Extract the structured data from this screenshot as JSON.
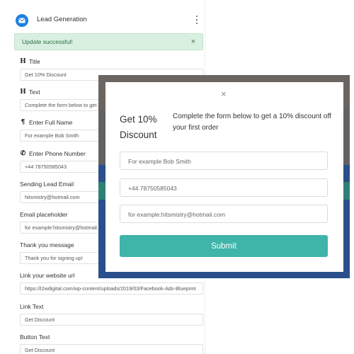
{
  "header": {
    "title": "Lead Generation",
    "app_icon": "envelope-icon",
    "menu_icon": "kebab-menu-icon"
  },
  "alert": {
    "text": "Update successful!",
    "close": "×"
  },
  "fields": [
    {
      "label": "Title",
      "icon": "heading-icon",
      "icon_glyph": "H",
      "value": "Get 10% Discount"
    },
    {
      "label": "Text",
      "icon": "heading-icon",
      "icon_glyph": "H",
      "value": "Complete the form below to get a"
    },
    {
      "label": "Enter Full Name",
      "icon": "paragraph-icon",
      "icon_glyph": "¶",
      "value": "For example Bob Smith"
    },
    {
      "label": "Enter Phone Number",
      "icon": "phone-icon",
      "icon_glyph": "✆",
      "value": "+44 78750585043"
    },
    {
      "label": "Sending Lead Email",
      "icon": "",
      "icon_glyph": "",
      "value": "hitsmistry@hotmail.com"
    },
    {
      "label": "Email placeholder",
      "icon": "",
      "icon_glyph": "",
      "value": "for example:hitsmistry@hotmail.com"
    },
    {
      "label": "Thank you message",
      "icon": "",
      "icon_glyph": "",
      "value": "Thank you for signing up!"
    },
    {
      "label": "Link your website url",
      "icon": "",
      "icon_glyph": "",
      "value": "https://i2wdigital.com/wp-content/uploads/2019/03/Facebook-Ads-Blueprint"
    },
    {
      "label": "Link Text",
      "icon": "",
      "icon_glyph": "",
      "value": "Get Discount"
    },
    {
      "label": "Button Text",
      "icon": "",
      "icon_glyph": "",
      "value": "Get Discount"
    }
  ],
  "popup": {
    "close": "×",
    "title": "Get 10% Discount",
    "description": "Complete the form below to get a 10% discount off your first order",
    "inputs": [
      "For example Bob Smith",
      "+44 78750585043",
      "for example:hitsmistry@hotmail.com"
    ],
    "submit": "Submit"
  },
  "colors": {
    "accent": "#3fb4a9",
    "icon_blue": "#1e7fe0",
    "alert_bg": "#d9f0e1",
    "overlay": "#626262"
  }
}
